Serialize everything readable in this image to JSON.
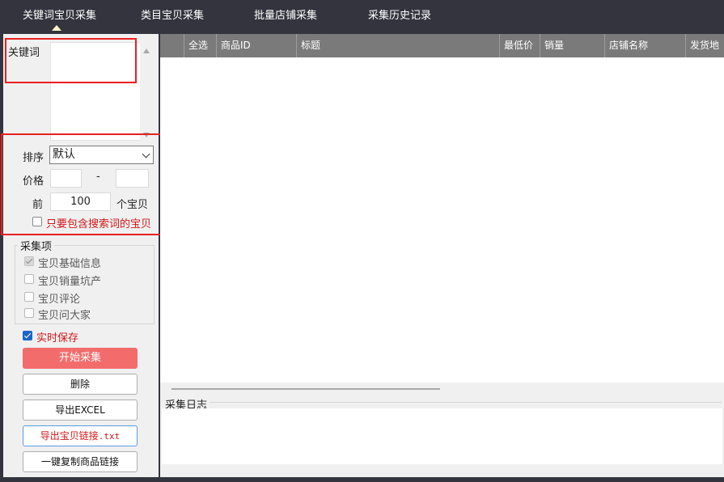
{
  "tabs": [
    {
      "label": "关键词宝贝采集",
      "active": true
    },
    {
      "label": "类目宝贝采集",
      "active": false
    },
    {
      "label": "批量店铺采集",
      "active": false
    },
    {
      "label": "采集历史记录",
      "active": false
    }
  ],
  "left_panel": {
    "keyword_label": "关键词",
    "keyword_value": "",
    "sort_label": "排序",
    "sort_value": "默认",
    "price_label": "价格",
    "price_separator": "-",
    "price_min": "",
    "price_max": "",
    "top_label": "前",
    "top_value": "100",
    "top_unit": "个宝贝",
    "only_search_label": "只要包含搜索词的宝贝",
    "only_search_checked": false,
    "collect_group_title": "采集项",
    "collect_items": [
      {
        "label": "宝贝基础信息",
        "checked": true
      },
      {
        "label": "宝贝销量坑产",
        "checked": false
      },
      {
        "label": "宝贝评论",
        "checked": false
      },
      {
        "label": "宝贝问大家",
        "checked": false
      }
    ],
    "realtime_save_label": "实时保存",
    "realtime_save_checked": true,
    "buttons": {
      "start": "开始采集",
      "delete": "删除",
      "export_excel": "导出EXCEL",
      "export_links_prefix": "导出宝贝链接",
      "export_links_ext": ".txt",
      "copy_links": "一键复制商品链接"
    }
  },
  "table": {
    "columns": [
      "",
      "全选",
      "商品ID",
      "标题",
      "最低价",
      "销量",
      "店铺名称",
      "发货地"
    ],
    "rows": []
  },
  "log": {
    "title": "采集日志",
    "content": ""
  },
  "colors": {
    "background": "#34343f",
    "header": "#7a7a7a",
    "accent_red": "#f36c6c",
    "highlight_border": "#e82020",
    "checkbox_blue": "#1b64c8"
  }
}
